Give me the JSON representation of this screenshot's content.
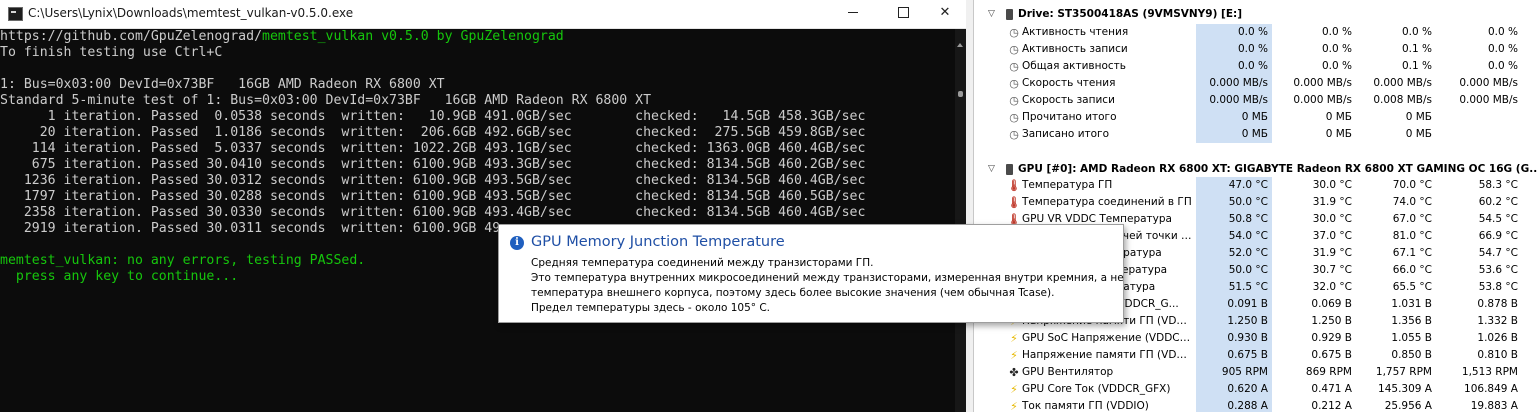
{
  "console": {
    "title": "C:\\Users\\Lynix\\Downloads\\memtest_vulkan-v0.5.0.exe",
    "lines": [
      {
        "parts": [
          {
            "text": "https://github.com/GpuZelenograd/",
            "cls": ""
          },
          {
            "text": "memtest_vulkan v0.5.0 by GpuZelenograd",
            "cls": "green"
          }
        ]
      },
      {
        "parts": [
          {
            "text": "To finish testing use Ctrl+C",
            "cls": ""
          }
        ]
      },
      {
        "parts": [
          {
            "text": "",
            "cls": ""
          }
        ]
      },
      {
        "parts": [
          {
            "text": "1: Bus=0x03:00 DevId=0x73BF   16GB AMD Radeon RX 6800 XT",
            "cls": ""
          }
        ]
      },
      {
        "parts": [
          {
            "text": "Standard 5-minute test of 1: Bus=0x03:00 DevId=0x73BF   16GB AMD Radeon RX 6800 XT",
            "cls": ""
          }
        ]
      },
      {
        "parts": [
          {
            "text": "      1 iteration. Passed  0.0538 seconds  written:   10.9GB 491.0GB/sec        checked:   14.5GB 458.3GB/sec",
            "cls": ""
          }
        ]
      },
      {
        "parts": [
          {
            "text": "     20 iteration. Passed  1.0186 seconds  written:  206.6GB 492.6GB/sec        checked:  275.5GB 459.8GB/sec",
            "cls": ""
          }
        ]
      },
      {
        "parts": [
          {
            "text": "    114 iteration. Passed  5.0337 seconds  written: 1022.2GB 493.1GB/sec        checked: 1363.0GB 460.4GB/sec",
            "cls": ""
          }
        ]
      },
      {
        "parts": [
          {
            "text": "    675 iteration. Passed 30.0410 seconds  written: 6100.9GB 493.3GB/sec        checked: 8134.5GB 460.2GB/sec",
            "cls": ""
          }
        ]
      },
      {
        "parts": [
          {
            "text": "   1236 iteration. Passed 30.0312 seconds  written: 6100.9GB 493.5GB/sec        checked: 8134.5GB 460.4GB/sec",
            "cls": ""
          }
        ]
      },
      {
        "parts": [
          {
            "text": "   1797 iteration. Passed 30.0288 seconds  written: 6100.9GB 493.5GB/sec        checked: 8134.5GB 460.5GB/sec",
            "cls": ""
          }
        ]
      },
      {
        "parts": [
          {
            "text": "   2358 iteration. Passed 30.0330 seconds  written: 6100.9GB 493.4GB/sec        checked: 8134.5GB 460.4GB/sec",
            "cls": ""
          }
        ]
      },
      {
        "parts": [
          {
            "text": "   2919 iteration. Passed 30.0311 seconds  written: 6100.9GB 49",
            "cls": ""
          }
        ]
      },
      {
        "parts": [
          {
            "text": "",
            "cls": ""
          }
        ]
      },
      {
        "parts": [
          {
            "text": "memtest_vulkan: no any errors, testing PASSed.",
            "cls": "green"
          }
        ]
      },
      {
        "parts": [
          {
            "text": "  press any key to continue...",
            "cls": "green"
          }
        ]
      }
    ]
  },
  "hwinfo": {
    "drive_group": {
      "label": "Drive: ST3500418AS (9VMSVNY9) [E:]"
    },
    "drive_rows": [
      {
        "icon": "◷",
        "icon_name": "clock-icon",
        "cls": "clock",
        "label": "Активность чтения",
        "v": [
          "0.0 %",
          "0.0 %",
          "0.0 %",
          "0.0 %"
        ]
      },
      {
        "icon": "◷",
        "icon_name": "clock-icon",
        "cls": "clock",
        "label": "Активность записи",
        "v": [
          "0.0 %",
          "0.0 %",
          "0.1 %",
          "0.0 %"
        ]
      },
      {
        "icon": "◷",
        "icon_name": "clock-icon",
        "cls": "clock",
        "label": "Общая активность",
        "v": [
          "0.0 %",
          "0.0 %",
          "0.1 %",
          "0.0 %"
        ]
      },
      {
        "icon": "◷",
        "icon_name": "clock-icon",
        "cls": "clock",
        "label": "Скорость чтения",
        "v": [
          "0.000 MB/s",
          "0.000 MB/s",
          "0.000 MB/s",
          "0.000 MB/s"
        ]
      },
      {
        "icon": "◷",
        "icon_name": "clock-icon",
        "cls": "clock",
        "label": "Скорость записи",
        "v": [
          "0.000 MB/s",
          "0.000 MB/s",
          "0.008 MB/s",
          "0.000 MB/s"
        ]
      },
      {
        "icon": "◷",
        "icon_name": "clock-icon",
        "cls": "clock",
        "label": "Прочитано итого",
        "v": [
          "0 МБ",
          "0 МБ",
          "0 МБ",
          ""
        ]
      },
      {
        "icon": "◷",
        "icon_name": "clock-icon",
        "cls": "clock",
        "label": "Записано итого",
        "v": [
          "0 МБ",
          "0 МБ",
          "0 МБ",
          ""
        ]
      }
    ],
    "gpu_group": {
      "label": "GPU [#0]: AMD Radeon RX 6800 XT: GIGABYTE Radeon RX 6800 XT GAMING OC 16G (G..."
    },
    "gpu_rows": [
      {
        "icon": "🌡",
        "icon_name": "thermometer-icon",
        "cls": "therm",
        "label": "Температура ГП",
        "v": [
          "47.0 °C",
          "30.0 °C",
          "70.0 °C",
          "58.3 °C"
        ]
      },
      {
        "icon": "🌡",
        "icon_name": "thermometer-icon",
        "cls": "therm",
        "label": "Температура соединений в ГП",
        "v": [
          "50.0 °C",
          "31.9 °C",
          "74.0 °C",
          "60.2 °C"
        ]
      },
      {
        "icon": "🌡",
        "icon_name": "thermometer-icon",
        "cls": "therm",
        "label": "GPU VR VDDC Температура",
        "v": [
          "50.8 °C",
          "30.0 °C",
          "67.0 °C",
          "54.5 °C"
        ]
      },
      {
        "icon": "🌡",
        "icon_name": "thermometer-icon",
        "cls": "therm",
        "label": "Температура горячей точки ГП",
        "v": [
          "54.0 °C",
          "37.0 °C",
          "81.0 °C",
          "66.9 °C"
        ]
      },
      {
        "icon": "🌡",
        "icon_name": "thermometer-icon",
        "cls": "therm",
        "label": "GPU VR SoC Температура",
        "v": [
          "52.0 °C",
          "31.9 °C",
          "67.1 °C",
          "54.7 °C"
        ]
      },
      {
        "icon": "🌡",
        "icon_name": "thermometer-icon",
        "cls": "therm",
        "label": "GPU VR Mem Температура",
        "v": [
          "50.0 °C",
          "30.7 °C",
          "66.0 °C",
          "53.6 °C"
        ]
      },
      {
        "icon": "🌡",
        "icon_name": "thermometer-icon",
        "cls": "therm",
        "label": "GPU Liquid Температура",
        "v": [
          "51.5 °C",
          "32.0 °C",
          "65.5 °C",
          "53.8 °C"
        ]
      },
      {
        "icon": "⚡",
        "icon_name": "lightning-icon",
        "cls": "bolt",
        "label": "Напряжение ГП (VDDCR_G...",
        "v": [
          "0.091 В",
          "0.069 В",
          "1.031 В",
          "0.878 В"
        ]
      },
      {
        "icon": "⚡",
        "icon_name": "lightning-icon",
        "cls": "bolt",
        "label": "Напряжение памяти ГП (VDDIO)",
        "v": [
          "1.250 В",
          "1.250 В",
          "1.356 В",
          "1.332 В"
        ]
      },
      {
        "icon": "⚡",
        "icon_name": "lightning-icon",
        "cls": "bolt",
        "label": "GPU SoC Напряжение (VDDCR_S...",
        "v": [
          "0.930 В",
          "0.929 В",
          "1.055 В",
          "1.026 В"
        ]
      },
      {
        "icon": "⚡",
        "icon_name": "lightning-icon",
        "cls": "bolt",
        "label": "Напряжение памяти ГП (VDDCI...",
        "v": [
          "0.675 В",
          "0.675 В",
          "0.850 В",
          "0.810 В"
        ]
      },
      {
        "icon": "✤",
        "icon_name": "fan-icon",
        "cls": "fan",
        "label": "GPU Вентилятор",
        "v": [
          "905 RPM",
          "869 RPM",
          "1,757 RPM",
          "1,513 RPM"
        ]
      },
      {
        "icon": "⚡",
        "icon_name": "lightning-icon",
        "cls": "bolt",
        "label": "GPU Core Ток (VDDCR_GFX)",
        "v": [
          "0.620 A",
          "0.471 A",
          "145.309 A",
          "106.849 A"
        ]
      },
      {
        "icon": "⚡",
        "icon_name": "lightning-icon",
        "cls": "bolt",
        "label": "Ток памяти ГП (VDDIO)",
        "v": [
          "0.288 A",
          "0.212 A",
          "25.956 A",
          "19.883 A"
        ]
      }
    ]
  },
  "tooltip": {
    "title": "GPU Memory Junction Temperature",
    "lines": [
      "Средняя температура соединений между транзисторами ГП.",
      "Это температура внутренних микросоединений между транзисторами, измеренная внутри кремния, а не",
      "температура внешнего корпуса, поэтому здесь более высокие значения (чем обычная Tcase).",
      "Предел температуры здесь - около 105° C."
    ]
  }
}
